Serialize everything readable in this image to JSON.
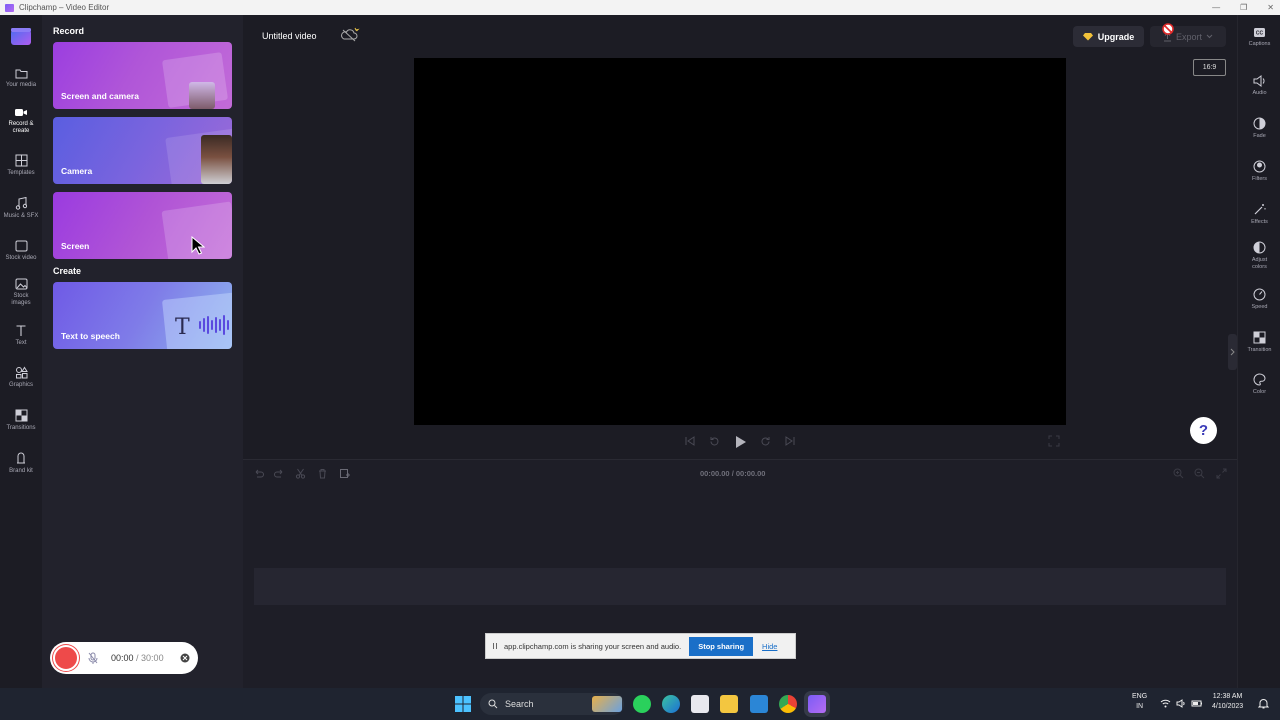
{
  "window": {
    "title": "Clipchamp – Video Editor"
  },
  "left_nav": {
    "items": [
      {
        "label": "Your media",
        "icon": "folder-icon"
      },
      {
        "label": "Record & create",
        "icon": "camera-icon",
        "active": true
      },
      {
        "label": "Templates",
        "icon": "templates-icon"
      },
      {
        "label": "Music & SFX",
        "icon": "music-icon"
      },
      {
        "label": "Stock video",
        "icon": "film-icon"
      },
      {
        "label": "Stock images",
        "icon": "image-icon"
      },
      {
        "label": "Text",
        "icon": "text-icon"
      },
      {
        "label": "Graphics",
        "icon": "shapes-icon"
      },
      {
        "label": "Transitions",
        "icon": "transitions-icon"
      },
      {
        "label": "Brand kit",
        "icon": "brand-icon"
      }
    ]
  },
  "panel": {
    "record_title": "Record",
    "create_title": "Create",
    "cards": [
      {
        "label": "Screen and camera"
      },
      {
        "label": "Camera"
      },
      {
        "label": "Screen"
      },
      {
        "label": "Text to speech"
      }
    ]
  },
  "header": {
    "project_title": "Untitled video",
    "upgrade_label": "Upgrade",
    "export_label": "Export",
    "aspect_ratio": "16:9"
  },
  "right_bar": {
    "items": [
      {
        "label": "Captions",
        "icon": "captions-icon"
      },
      {
        "label": "Audio",
        "icon": "speaker-icon"
      },
      {
        "label": "Fade",
        "icon": "fade-icon"
      },
      {
        "label": "Filters",
        "icon": "filters-icon"
      },
      {
        "label": "Effects",
        "icon": "wand-icon"
      },
      {
        "label": "Adjust colors",
        "icon": "contrast-icon"
      },
      {
        "label": "Speed",
        "icon": "speedometer-icon"
      },
      {
        "label": "Transition",
        "icon": "transition-icon"
      },
      {
        "label": "Color",
        "icon": "palette-icon"
      }
    ]
  },
  "timeline": {
    "time_current": "00:00.00",
    "time_separator": " / ",
    "time_total": "00:00.00"
  },
  "help": {
    "label": "?"
  },
  "recorder": {
    "elapsed": "00:00",
    "separator": " / ",
    "limit": "30:00"
  },
  "share_bar": {
    "message": "app.clipchamp.com is sharing your screen and audio.",
    "stop_label": "Stop sharing",
    "hide_label": "Hide"
  },
  "taskbar": {
    "search_label": "Search",
    "lang_top": "ENG",
    "lang_bottom": "IN",
    "time": "12:38 AM",
    "date": "4/10/2023"
  }
}
